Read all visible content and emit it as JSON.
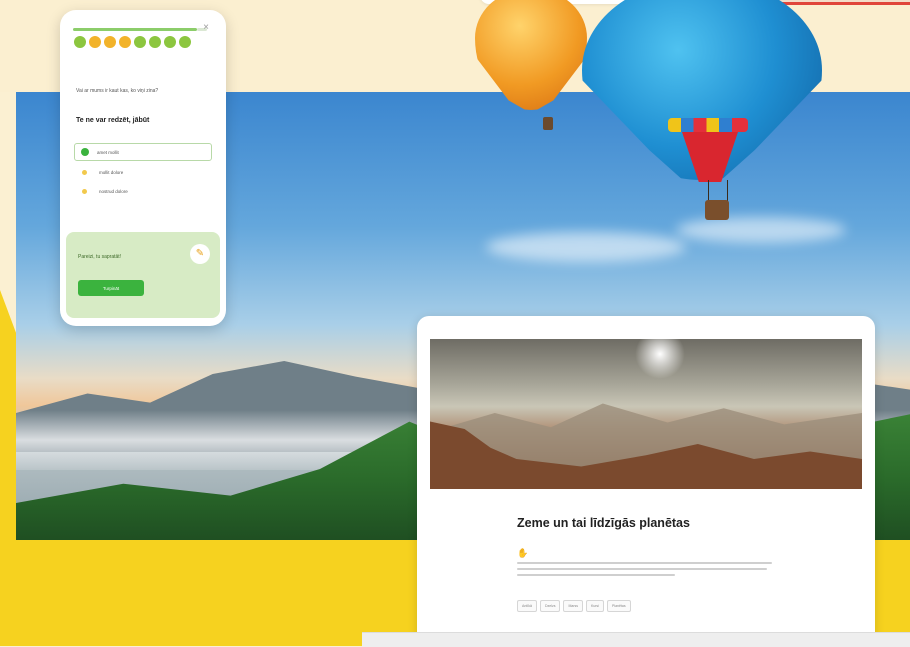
{
  "phone": {
    "question_small": "Vai ar mums ir kaut kas, ko viņi zina?",
    "question": "Te ne var redzēt, jābūt",
    "options": [
      {
        "label": "amet mollit",
        "state": "correct"
      },
      {
        "label": "mollit dolore",
        "state": "neutral"
      },
      {
        "label": "nostrud dolore",
        "state": "neutral"
      }
    ],
    "feedback_text": "Pareizi, tu sapratāt!",
    "continue_label": "Turpināt",
    "progress_dots": [
      "#8cc63f",
      "#f2b32a",
      "#f2b32a",
      "#f2b32a",
      "#8cc63f",
      "#8cc63f",
      "#8cc63f",
      "#8cc63f"
    ],
    "close_glyph": "×",
    "feedback_icon_glyph": "✎"
  },
  "article": {
    "title": "Zeme un tai līdzīgās planētas",
    "hand_glyph": "✋",
    "tags": [
      "Antīkā",
      "Dzelzs",
      "Marss",
      "Kursi",
      "Planētas"
    ]
  },
  "colors": {
    "accent_green": "#3bb33e",
    "brand_yellow": "#f6d21f",
    "top_red": "#e0453a"
  }
}
